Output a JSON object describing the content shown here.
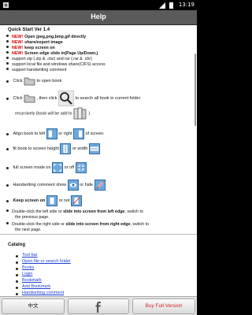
{
  "status_bar": {
    "time": "13:19"
  },
  "window": {
    "title": "Help"
  },
  "quick_start": {
    "heading": "Quick Start Ver 1.4",
    "features": [
      {
        "new_tag": "NEW!",
        "text": "Open jpeg,png,bmp,gif directly"
      },
      {
        "new_tag": "NEW!",
        "text": "share/export image"
      },
      {
        "new_tag": "NEW!",
        "text": "keep screen on"
      },
      {
        "new_tag": "NEW!",
        "text": "Screen edge slide in(Page Up/Down,)"
      },
      {
        "text": "support zip (.zip & .cbz) and rar (.rar & .cbr)"
      },
      {
        "text": "support local file and windows share(CIFS) access"
      },
      {
        "text": "support handwriting comment"
      }
    ],
    "click": "Click",
    "to_open_book": "to open book",
    "then_click": ", then click",
    "to_search": "to search all book in current folder",
    "recursively": "recursively (book will be add to",
    "recursively_end": ")",
    "align_book": "Align book to left",
    "or_right": "or right",
    "of_screen": "of screen.",
    "fit_book": "fit book to screen height",
    "or_width": "or width",
    "full_screen": "full screen mode on",
    "or_off": "or off",
    "handwriting": "Handwriting comment show",
    "or_hide": "or hide",
    "keep_screen_on": "Keep screen on",
    "or_not": "or not",
    "dbl_left_1": "Double-click the left side or ",
    "dbl_left_bold": "slide into screen from left edge",
    "dbl_left_2": ", switch to",
    "dbl_left_3": "the previous page.",
    "dbl_right_1": "Double-click the right side or ",
    "dbl_right_bold": "slide into screen from right edge",
    "dbl_right_2": ", switch to",
    "dbl_right_3": "the next page."
  },
  "catalog": {
    "heading": "Catalog",
    "links": [
      "Tool bar",
      "Open file or search folder",
      "Books",
      "Login",
      "Bookmark",
      "Add Bookmark",
      "Handwriting comment"
    ]
  },
  "bottom_bar": {
    "lang_button": "中文",
    "buy_button": "Buy Full Version"
  },
  "icons": {
    "folder": "folder-icon",
    "search": "magnifier-icon",
    "books": "books-icon",
    "align_left": "align-left-icon",
    "align_right": "align-right-icon",
    "fit_height": "fit-height-icon",
    "fit_width": "fit-width-icon",
    "fullscreen_on": "fullscreen-on-icon",
    "fullscreen_off": "fullscreen-off-icon",
    "eye": "eye-icon",
    "pencil_hide": "pencil-hide-icon",
    "keep_on": "keep-screen-on-icon",
    "keep_off": "keep-screen-off-icon"
  },
  "colors": {
    "new_tag": "#e00000",
    "link": "#1a3fd6",
    "titlebar": "#5a5a5a",
    "buy": "#d22222"
  }
}
